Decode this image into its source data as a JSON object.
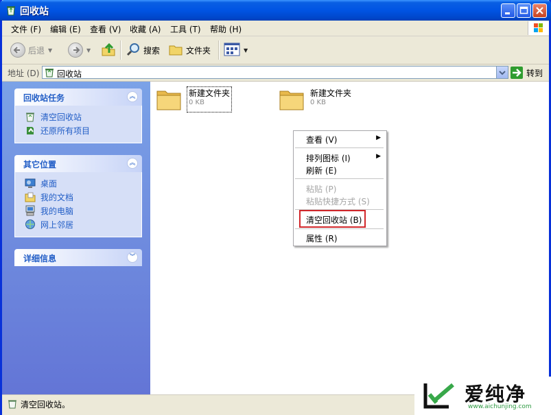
{
  "window": {
    "title": "回收站",
    "accent": "#0054e3"
  },
  "menubar": {
    "items": [
      {
        "label": "文件 (F)"
      },
      {
        "label": "编辑 (E)"
      },
      {
        "label": "查看 (V)"
      },
      {
        "label": "收藏 (A)"
      },
      {
        "label": "工具 (T)"
      },
      {
        "label": "帮助 (H)"
      }
    ]
  },
  "toolbar": {
    "back_label": "后退",
    "search_label": "搜索",
    "folders_label": "文件夹"
  },
  "address": {
    "label": "地址 (D)",
    "value": "回收站",
    "go_label": "转到"
  },
  "left_pane": {
    "tasks": {
      "title": "回收站任务",
      "items": [
        {
          "label": "清空回收站"
        },
        {
          "label": "还原所有项目"
        }
      ]
    },
    "places": {
      "title": "其它位置",
      "items": [
        {
          "label": "桌面"
        },
        {
          "label": "我的文档"
        },
        {
          "label": "我的电脑"
        },
        {
          "label": "网上邻居"
        }
      ]
    },
    "details": {
      "title": "详细信息"
    }
  },
  "files": [
    {
      "name": "新建文件夹",
      "size": "0 KB"
    },
    {
      "name": "新建文件夹",
      "size": "0 KB"
    }
  ],
  "context_menu": {
    "items": [
      {
        "label": "查看 (V)",
        "submenu": true
      },
      {
        "label": "排列图标 (I)",
        "submenu": true
      },
      {
        "label": "刷新 (E)"
      },
      {
        "label": "粘贴 (P)",
        "disabled": true
      },
      {
        "label": "粘贴快捷方式 (S)",
        "disabled": true
      },
      {
        "label": "清空回收站 (B)",
        "highlighted": true
      },
      {
        "label": "属性 (R)"
      }
    ],
    "highlight_color": "#d1262a"
  },
  "statusbar": {
    "text": "清空回收站。"
  },
  "watermark": {
    "brand": "爱纯净",
    "url": "www.aichunjing.com"
  }
}
